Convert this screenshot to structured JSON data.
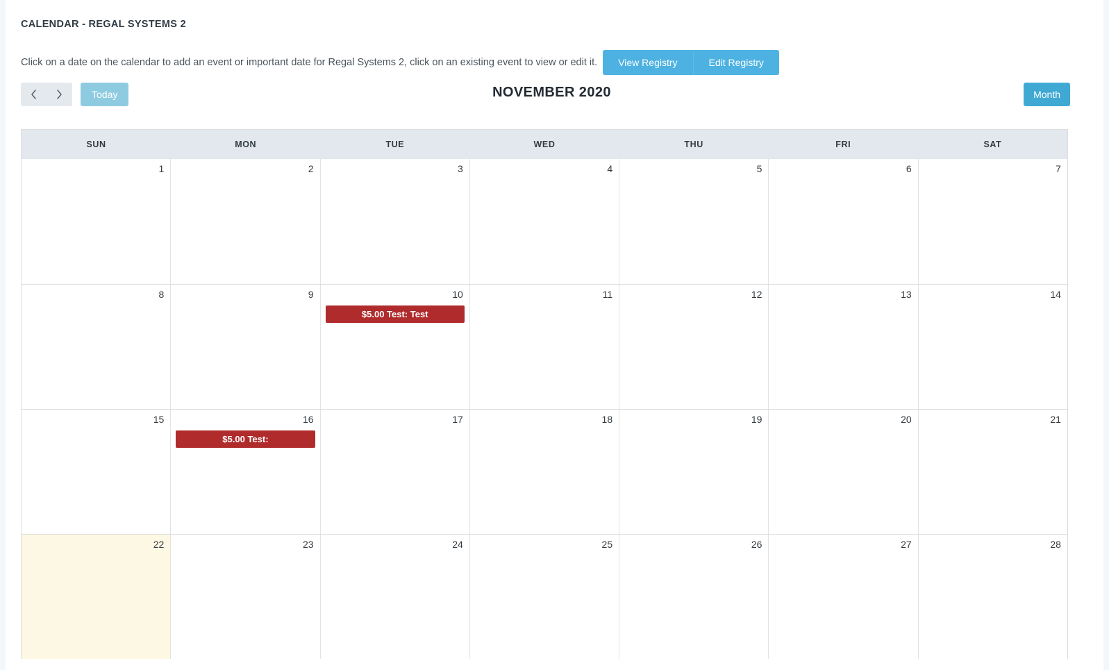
{
  "page_title": "CALENDAR - REGAL SYSTEMS 2",
  "intro": {
    "text": "Click on a date on the calendar to add an event or important date for Regal Systems 2, click on an existing event to view or edit it.",
    "view_registry_label": "View Registry",
    "edit_registry_label": "Edit Registry"
  },
  "toolbar": {
    "prev_icon": "chevron-left-icon",
    "next_icon": "chevron-right-icon",
    "today_label": "Today",
    "month_label": "Month",
    "calendar_title": "NOVEMBER 2020"
  },
  "colors": {
    "primary_blue": "#4db2e2",
    "month_blue": "#3fa9d4",
    "today_blue": "#8fcbe0",
    "event_red": "#b02b2c",
    "header_bg": "#e2e8ee",
    "today_cell_bg": "#fcf8e3",
    "page_bg": "#f4f7fa"
  },
  "calendar": {
    "weekdays": [
      "SUN",
      "MON",
      "TUE",
      "WED",
      "THU",
      "FRI",
      "SAT"
    ],
    "weeks": [
      [
        {
          "day": "1",
          "today": false,
          "events": []
        },
        {
          "day": "2",
          "today": false,
          "events": []
        },
        {
          "day": "3",
          "today": false,
          "events": []
        },
        {
          "day": "4",
          "today": false,
          "events": []
        },
        {
          "day": "5",
          "today": false,
          "events": []
        },
        {
          "day": "6",
          "today": false,
          "events": []
        },
        {
          "day": "7",
          "today": false,
          "events": []
        }
      ],
      [
        {
          "day": "8",
          "today": false,
          "events": []
        },
        {
          "day": "9",
          "today": false,
          "events": []
        },
        {
          "day": "10",
          "today": false,
          "events": [
            {
              "title": "$5.00 Test: Test"
            }
          ]
        },
        {
          "day": "11",
          "today": false,
          "events": []
        },
        {
          "day": "12",
          "today": false,
          "events": []
        },
        {
          "day": "13",
          "today": false,
          "events": []
        },
        {
          "day": "14",
          "today": false,
          "events": []
        }
      ],
      [
        {
          "day": "15",
          "today": false,
          "events": []
        },
        {
          "day": "16",
          "today": false,
          "events": [
            {
              "title": "$5.00 Test:"
            }
          ]
        },
        {
          "day": "17",
          "today": false,
          "events": []
        },
        {
          "day": "18",
          "today": false,
          "events": []
        },
        {
          "day": "19",
          "today": false,
          "events": []
        },
        {
          "day": "20",
          "today": false,
          "events": []
        },
        {
          "day": "21",
          "today": false,
          "events": []
        }
      ],
      [
        {
          "day": "22",
          "today": true,
          "events": []
        },
        {
          "day": "23",
          "today": false,
          "events": []
        },
        {
          "day": "24",
          "today": false,
          "events": []
        },
        {
          "day": "25",
          "today": false,
          "events": []
        },
        {
          "day": "26",
          "today": false,
          "events": []
        },
        {
          "day": "27",
          "today": false,
          "events": []
        },
        {
          "day": "28",
          "today": false,
          "events": []
        }
      ]
    ]
  }
}
